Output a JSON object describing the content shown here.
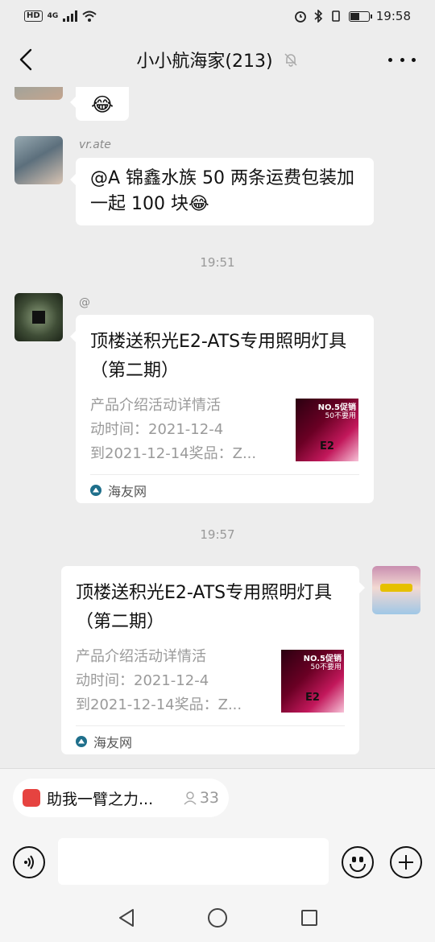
{
  "status_bar": {
    "hd": "HD",
    "network": "4G",
    "time": "19:58"
  },
  "header": {
    "title": "小小航海家(213)",
    "back_icon": "chevron-left-icon",
    "mute_icon": "bell-off-icon",
    "more_icon": "more-dots-icon"
  },
  "messages": [
    {
      "type": "emoji",
      "side": "left",
      "content": "😂"
    },
    {
      "type": "text",
      "side": "left",
      "nickname": "vr.ate",
      "content": "@A 锦鑫水族  50 两条运费包装加一起 100 块😂"
    },
    {
      "type": "time",
      "content": "19:51"
    },
    {
      "type": "link",
      "side": "left",
      "nickname": "@",
      "title": "顶楼送积光E2-ATS专用照明灯具（第二期）",
      "description": "产品介绍活动详情活\n动时间：2021-12-4\n到2021-12-14奖品：Z...",
      "thumb_text_1": "NO.5促销",
      "thumb_text_2": "50不要用",
      "thumb_mark": "E2",
      "source": "海友网"
    },
    {
      "type": "time",
      "content": "19:57"
    },
    {
      "type": "link",
      "side": "right",
      "title": "顶楼送积光E2-ATS专用照明灯具（第二期）",
      "description": "产品介绍活动详情活\n动时间：2021-12-4\n到2021-12-14奖品：Z...",
      "thumb_text_1": "NO.5促销",
      "thumb_text_2": "50不要用",
      "thumb_mark": "E2",
      "source": "海友网"
    }
  ],
  "bottom": {
    "pill_label": "助我一臂之力...",
    "pill_count": "33",
    "input_value": "",
    "voice_icon": "voice-icon",
    "emoji_icon": "emoji-icon",
    "plus_icon": "plus-circle-icon"
  },
  "nav": {
    "back_icon": "triangle-back-icon",
    "home_icon": "circle-home-icon",
    "recent_icon": "square-recent-icon"
  }
}
